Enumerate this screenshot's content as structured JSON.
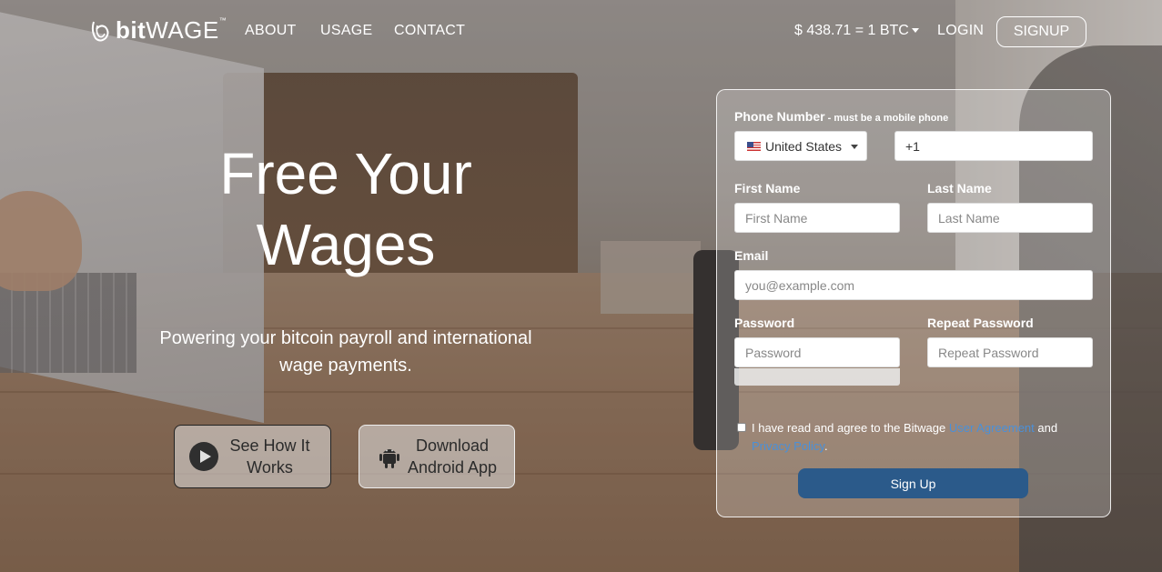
{
  "nav": {
    "logo_bold": "bit",
    "logo_light": "WAGE",
    "logo_tm": "™",
    "about": "ABOUT",
    "usage": "USAGE",
    "contact": "CONTACT",
    "rate": "$ 438.71 = 1 BTC",
    "login": "LOGIN",
    "signup": "SIGNUP"
  },
  "hero": {
    "title_line1": "Free Your",
    "title_line2": "Wages",
    "subtitle_line1": "Powering your bitcoin payroll and international",
    "subtitle_line2": "wage payments.",
    "how_line1": "See How It",
    "how_line2": "Works",
    "android_line1": "Download",
    "android_line2": "Android App",
    "how_icon": "play-icon",
    "android_icon": "android-icon"
  },
  "form": {
    "phone_label": "Phone Number",
    "phone_note": " - must be a mobile phone",
    "country": "United States",
    "phone_prefix": "+1",
    "first_name_label": "First Name",
    "first_name_placeholder": "First Name",
    "last_name_label": "Last Name",
    "last_name_placeholder": "Last Name",
    "email_label": "Email",
    "email_placeholder": "you@example.com",
    "password_label": "Password",
    "password_placeholder": "Password",
    "repeat_label": "Repeat Password",
    "repeat_placeholder": "Repeat Password",
    "agree_text": "I have read and agree to the Bitwage ",
    "agree_link1": "User Agreement",
    "agree_and": " and ",
    "agree_link2": "Privacy Policy",
    "agree_end": ".",
    "submit": "Sign Up"
  },
  "colors": {
    "submit_bg": "#2b5a8a",
    "link": "#4a90d9"
  }
}
